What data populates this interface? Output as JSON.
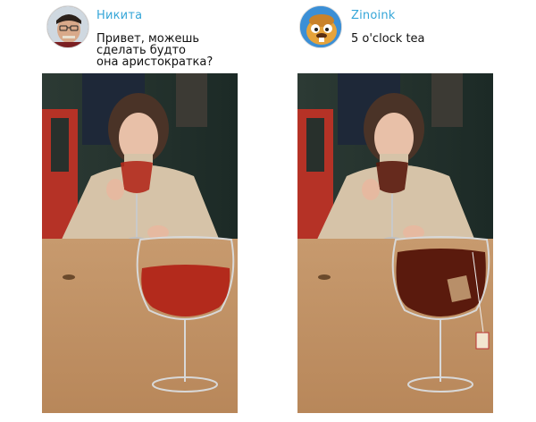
{
  "panels": [
    {
      "user": {
        "name": "Никита",
        "avatar_icon": "user-photo-avatar"
      },
      "message": "Привет, можешь\nсделать будто\nона аристократка?",
      "photo": {
        "drink": "red-wine-glass",
        "drink_color": "#b32a1c"
      }
    },
    {
      "user": {
        "name": "Zinoink",
        "avatar_icon": "cartoon-beaver-avatar"
      },
      "message": "5 o'clock tea",
      "photo": {
        "drink": "tea-in-wine-glass",
        "drink_color": "#5a1a0d"
      }
    }
  ]
}
